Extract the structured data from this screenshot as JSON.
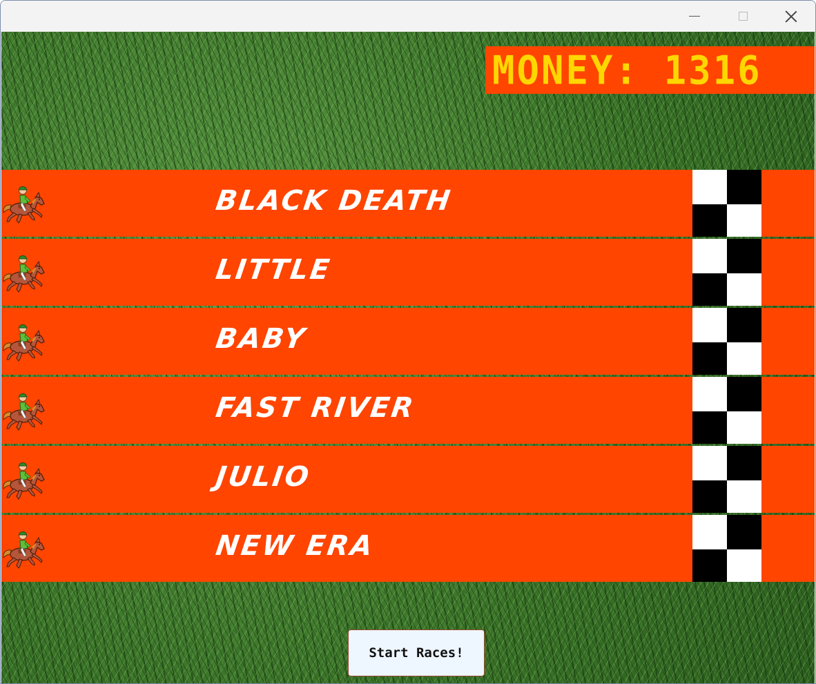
{
  "window": {
    "controls": {
      "minimize_icon": "minimize-icon",
      "maximize_icon": "maximize-icon",
      "close_icon": "close-icon"
    }
  },
  "money": {
    "label": "MONEY: 1316"
  },
  "colors": {
    "lane": "#ff4500",
    "money_text": "#ffd700",
    "lane_text": "#ffffff"
  },
  "lanes": [
    {
      "name": "BLACK DEATH",
      "icon": "horse-racing-icon"
    },
    {
      "name": "LITTLE",
      "icon": "horse-racing-icon"
    },
    {
      "name": "BABY",
      "icon": "horse-racing-icon"
    },
    {
      "name": "FAST RIVER",
      "icon": "horse-racing-icon"
    },
    {
      "name": "JULIO",
      "icon": "horse-racing-icon"
    },
    {
      "name": "NEW ERA",
      "icon": "horse-racing-icon"
    }
  ],
  "start_button": {
    "label": "Start Races!"
  }
}
